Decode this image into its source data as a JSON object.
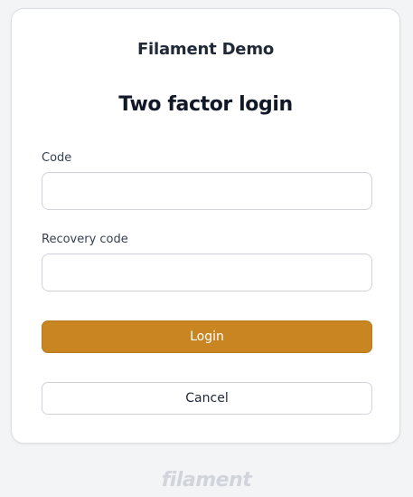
{
  "brand": {
    "name": "Filament Demo"
  },
  "heading": {
    "title": "Two factor login"
  },
  "form": {
    "code": {
      "label": "Code",
      "value": "",
      "placeholder": ""
    },
    "recovery_code": {
      "label": "Recovery code",
      "value": "",
      "placeholder": ""
    }
  },
  "actions": {
    "login_label": "Login",
    "cancel_label": "Cancel"
  },
  "footer": {
    "logo_text": "filament"
  },
  "colors": {
    "primary": "#c88522",
    "background": "#f3f4f6",
    "card": "#ffffff"
  }
}
